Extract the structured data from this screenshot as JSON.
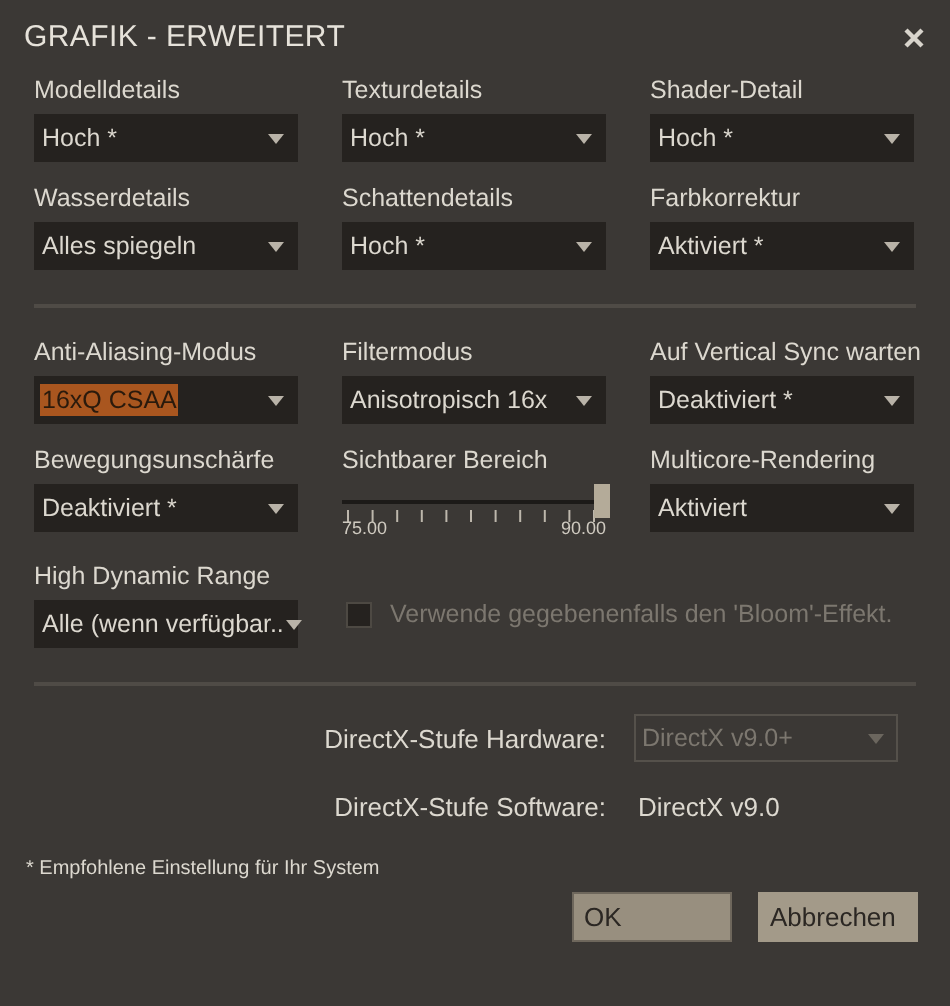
{
  "window": {
    "title": "GRAFIK - ERWEITERT"
  },
  "groups": [
    [
      {
        "kind": "dropdown",
        "label": "Modelldetails",
        "value": "Hoch *",
        "highlighted": false
      },
      {
        "kind": "dropdown",
        "label": "Texturdetails",
        "value": "Hoch *",
        "highlighted": false
      },
      {
        "kind": "dropdown",
        "label": "Shader-Detail",
        "value": "Hoch *",
        "highlighted": false
      },
      {
        "kind": "dropdown",
        "label": "Wasserdetails",
        "value": "Alles spiegeln",
        "highlighted": false
      },
      {
        "kind": "dropdown",
        "label": "Schattendetails",
        "value": "Hoch *",
        "highlighted": false
      },
      {
        "kind": "dropdown",
        "label": "Farbkorrektur",
        "value": "Aktiviert *",
        "highlighted": false
      }
    ],
    [
      {
        "kind": "dropdown",
        "label": "Anti-Aliasing-Modus",
        "value": "16xQ CSAA",
        "highlighted": true
      },
      {
        "kind": "dropdown",
        "label": "Filtermodus",
        "value": "Anisotropisch 16x",
        "highlighted": false
      },
      {
        "kind": "dropdown",
        "label": "Auf Vertical Sync warten",
        "value": "Deaktiviert *",
        "highlighted": false
      },
      {
        "kind": "dropdown",
        "label": "Bewegungsunschärfe",
        "value": "Deaktiviert *",
        "highlighted": false
      },
      {
        "kind": "slider",
        "label": "Sichtbarer Bereich",
        "level": 1,
        "min_label": "75.00",
        "max_label": "90.00"
      },
      {
        "kind": "dropdown",
        "label": "Multicore-Rendering",
        "value": "Aktiviert",
        "highlighted": false
      },
      {
        "kind": "dropdown",
        "label": "High Dynamic Range",
        "value": "Alle (wenn verfügbar..",
        "highlighted": false
      },
      {
        "kind": "checkbox",
        "label": "Verwende gegebenenfalls den 'Bloom'-Effekt.",
        "checked": false,
        "disabled": true
      }
    ]
  ],
  "directx": [
    {
      "kind": "dropdown",
      "label": "DirectX-Stufe Hardware:",
      "value": "DirectX v9.0+",
      "disabled": true
    },
    {
      "kind": "text",
      "label": "DirectX-Stufe Software:",
      "value": "DirectX v9.0",
      "disabled": false
    }
  ],
  "footnote": "* Empfohlene Einstellung für Ihr System",
  "buttons": [
    {
      "label": "OK",
      "focused": true
    },
    {
      "label": "Abbrechen",
      "focused": false
    }
  ]
}
